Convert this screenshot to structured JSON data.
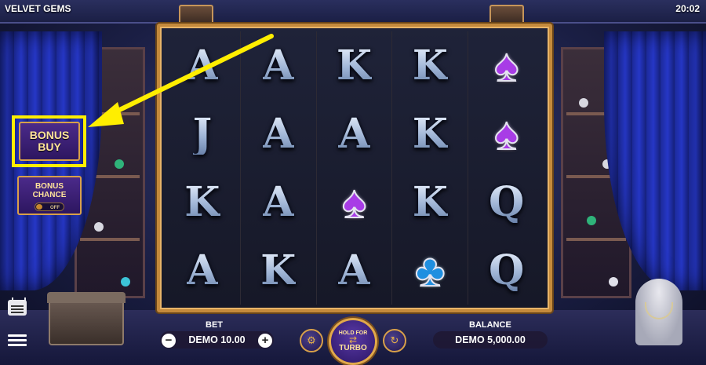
{
  "header": {
    "game_title": "VELVET GEMS",
    "clock": "20:02"
  },
  "reels": [
    [
      {
        "kind": "letter",
        "text": "A"
      },
      {
        "kind": "letter",
        "text": "A"
      },
      {
        "kind": "letter",
        "text": "K"
      },
      {
        "kind": "letter",
        "text": "K"
      },
      {
        "kind": "suit",
        "icon": "spade-icon",
        "glyph": "♠",
        "color": "#a83ce6"
      }
    ],
    [
      {
        "kind": "letter",
        "text": "J"
      },
      {
        "kind": "letter",
        "text": "A"
      },
      {
        "kind": "letter",
        "text": "A"
      },
      {
        "kind": "letter",
        "text": "K"
      },
      {
        "kind": "suit",
        "icon": "spade-icon",
        "glyph": "♠",
        "color": "#a83ce6"
      }
    ],
    [
      {
        "kind": "letter",
        "text": "K"
      },
      {
        "kind": "letter",
        "text": "A"
      },
      {
        "kind": "suit",
        "icon": "spade-icon",
        "glyph": "♠",
        "color": "#a83ce6"
      },
      {
        "kind": "letter",
        "text": "K"
      },
      {
        "kind": "letter",
        "text": "Q"
      }
    ],
    [
      {
        "kind": "letter",
        "text": "A"
      },
      {
        "kind": "letter",
        "text": "K"
      },
      {
        "kind": "letter",
        "text": "A"
      },
      {
        "kind": "suit",
        "icon": "club-icon",
        "glyph": "♣",
        "color": "#1f8fe0"
      },
      {
        "kind": "letter",
        "text": "Q"
      }
    ]
  ],
  "side_buttons": {
    "bonus_buy_line1": "BONUS",
    "bonus_buy_line2": "BUY",
    "bonus_chance_line1": "BONUS",
    "bonus_chance_line2": "CHANCE",
    "bonus_chance_toggle": "OFF"
  },
  "bottom_bar": {
    "bet_label": "BET",
    "bet_value": "DEMO 10.00",
    "minus_glyph": "−",
    "plus_glyph": "+",
    "spin_line1": "HOLD FOR",
    "spin_line2": "TURBO",
    "balance_label": "BALANCE",
    "balance_value": "DEMO 5,000.00"
  },
  "icons": [
    "paytable-icon",
    "menu-icon",
    "autoplay-icon",
    "turbo-icon",
    "spin-icon",
    "arrow-icon"
  ],
  "colors": {
    "highlight": "#ffee00",
    "frame_gold": "#c48a3c",
    "button_purple": "#2d1660"
  }
}
